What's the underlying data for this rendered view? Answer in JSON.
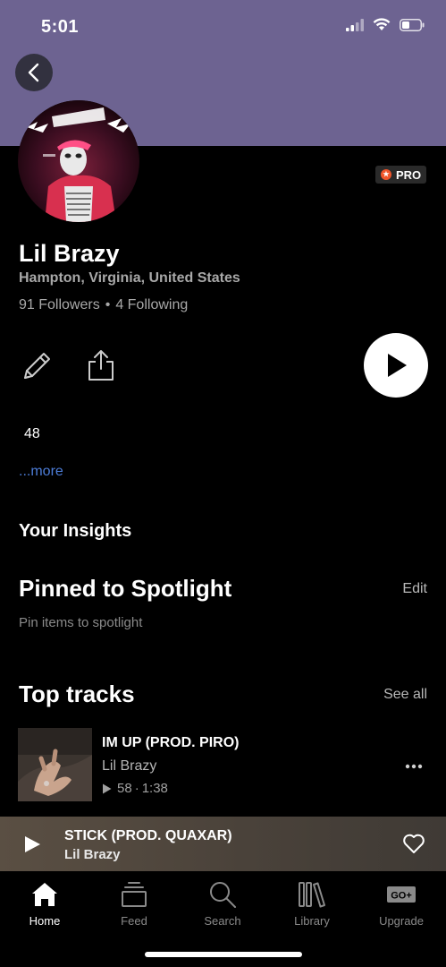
{
  "status_bar": {
    "time": "5:01"
  },
  "profile": {
    "name": "Lil Brazy",
    "location": "Hampton, Virginia, United States",
    "followers": "91 Followers",
    "separator": "•",
    "following": "4 Following",
    "badge": "PRO",
    "bio_number": "48",
    "more_link": "...more"
  },
  "insights": {
    "title": "Your Insights"
  },
  "spotlight": {
    "title": "Pinned to Spotlight",
    "edit_label": "Edit",
    "subtitle": "Pin items to spotlight"
  },
  "top_tracks": {
    "title": "Top tracks",
    "see_all_label": "See all",
    "items": [
      {
        "title": "IM UP (PROD. PIRO)",
        "artist": "Lil Brazy",
        "plays": "58",
        "duration": "1:38"
      }
    ]
  },
  "now_playing": {
    "title": "STICK (PROD. QUAXAR)",
    "artist": "Lil Brazy"
  },
  "tabs": [
    {
      "label": "Home",
      "icon": "home-icon",
      "active": true
    },
    {
      "label": "Feed",
      "icon": "feed-icon",
      "active": false
    },
    {
      "label": "Search",
      "icon": "search-icon",
      "active": false
    },
    {
      "label": "Library",
      "icon": "library-icon",
      "active": false
    },
    {
      "label": "Upgrade",
      "icon": "go-plus-icon",
      "active": false
    }
  ],
  "go_plus_text": "GO+",
  "colors": {
    "banner": "#6d6391",
    "link": "#4d7dd8",
    "pro_accent": "#f0552a"
  }
}
